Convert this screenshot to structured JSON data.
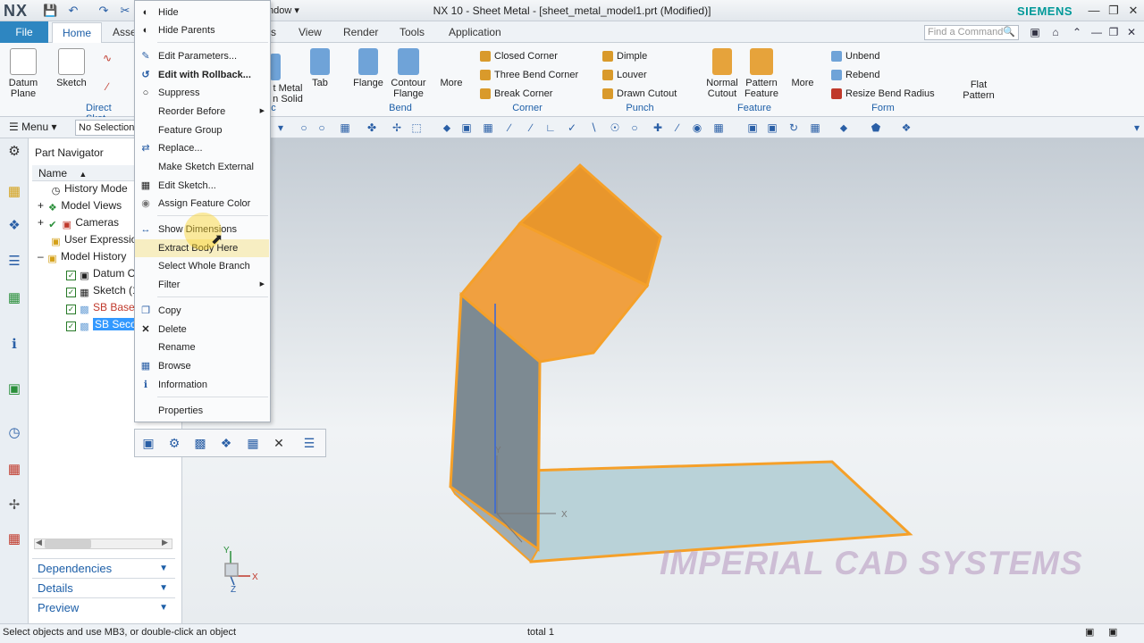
{
  "titlebar": {
    "logo": "NX",
    "title": "NX 10 - Sheet Metal - [sheet_metal_model1.prt (Modified)]",
    "window_menu": "ndow ▾",
    "brand": "SIEMENS"
  },
  "tabs": {
    "file": "File",
    "home": "Home",
    "assemblies": "Asse",
    "view": "View",
    "render": "Render",
    "tools": "Tools",
    "application": "Application",
    "partial": "s"
  },
  "find_command": {
    "placeholder": "Find a Command"
  },
  "ribbon": {
    "datum_plane": "Datum Plane",
    "sketch": "Sketch",
    "direct_sketch": "Direct Sket",
    "convert_solid_a": "t Metal",
    "convert_solid_b": "n Solid",
    "tab": "Tab",
    "flange": "Flange",
    "contour_flange": "Contour Flange",
    "more": "More",
    "bend_label": "Bend",
    "corner": [
      "Closed Corner",
      "Three Bend Corner",
      "Break Corner"
    ],
    "corner_label": "Corner",
    "punch": [
      "Dimple",
      "Louver",
      "Drawn Cutout"
    ],
    "punch_label": "Punch",
    "normal_cutout": "Normal Cutout",
    "pattern_feature": "Pattern Feature",
    "more2": "More",
    "feature_label": "Feature",
    "form": [
      "Unbend",
      "Rebend",
      "Resize Bend Radius"
    ],
    "flat_pattern": "Flat Pattern",
    "form_label": "Form",
    "c_label": "c"
  },
  "cmdbar": {
    "menu": "Menu",
    "selection_filter": "No Selection"
  },
  "navigator": {
    "title": "Part Navigator",
    "column": "Name",
    "items": [
      {
        "label": "History Mode"
      },
      {
        "label": "Model Views"
      },
      {
        "label": "Cameras"
      },
      {
        "label": "User Expression"
      },
      {
        "label": "Model History"
      },
      {
        "label": "Datum C"
      },
      {
        "label": "Sketch (1"
      },
      {
        "label": "SB Base C"
      },
      {
        "label": "SB Seco"
      }
    ],
    "panels": [
      "Dependencies",
      "Details",
      "Preview"
    ]
  },
  "context_menu": {
    "items": [
      "Hide",
      "Hide Parents",
      "Edit Parameters...",
      "Edit with Rollback...",
      "Suppress",
      "Reorder Before",
      "Feature Group",
      "Replace...",
      "Make Sketch External",
      "Edit Sketch...",
      "Assign Feature Color",
      "Show Dimensions",
      "Extract Body Here",
      "Select Whole Branch",
      "Filter",
      "Copy",
      "Delete",
      "Rename",
      "Browse",
      "Information",
      "Properties"
    ]
  },
  "viewport": {
    "watermark": "IMPERIAL CAD SYSTEMS",
    "axis_y": "Y",
    "axis_x": "X",
    "axis_z": "Z"
  },
  "status": {
    "message": "Select objects and use MB3, or double-click an object",
    "total": "total 1"
  },
  "colors": {
    "accent": "#2e86c1",
    "selection": "#f5a029",
    "brand": "#009999"
  }
}
